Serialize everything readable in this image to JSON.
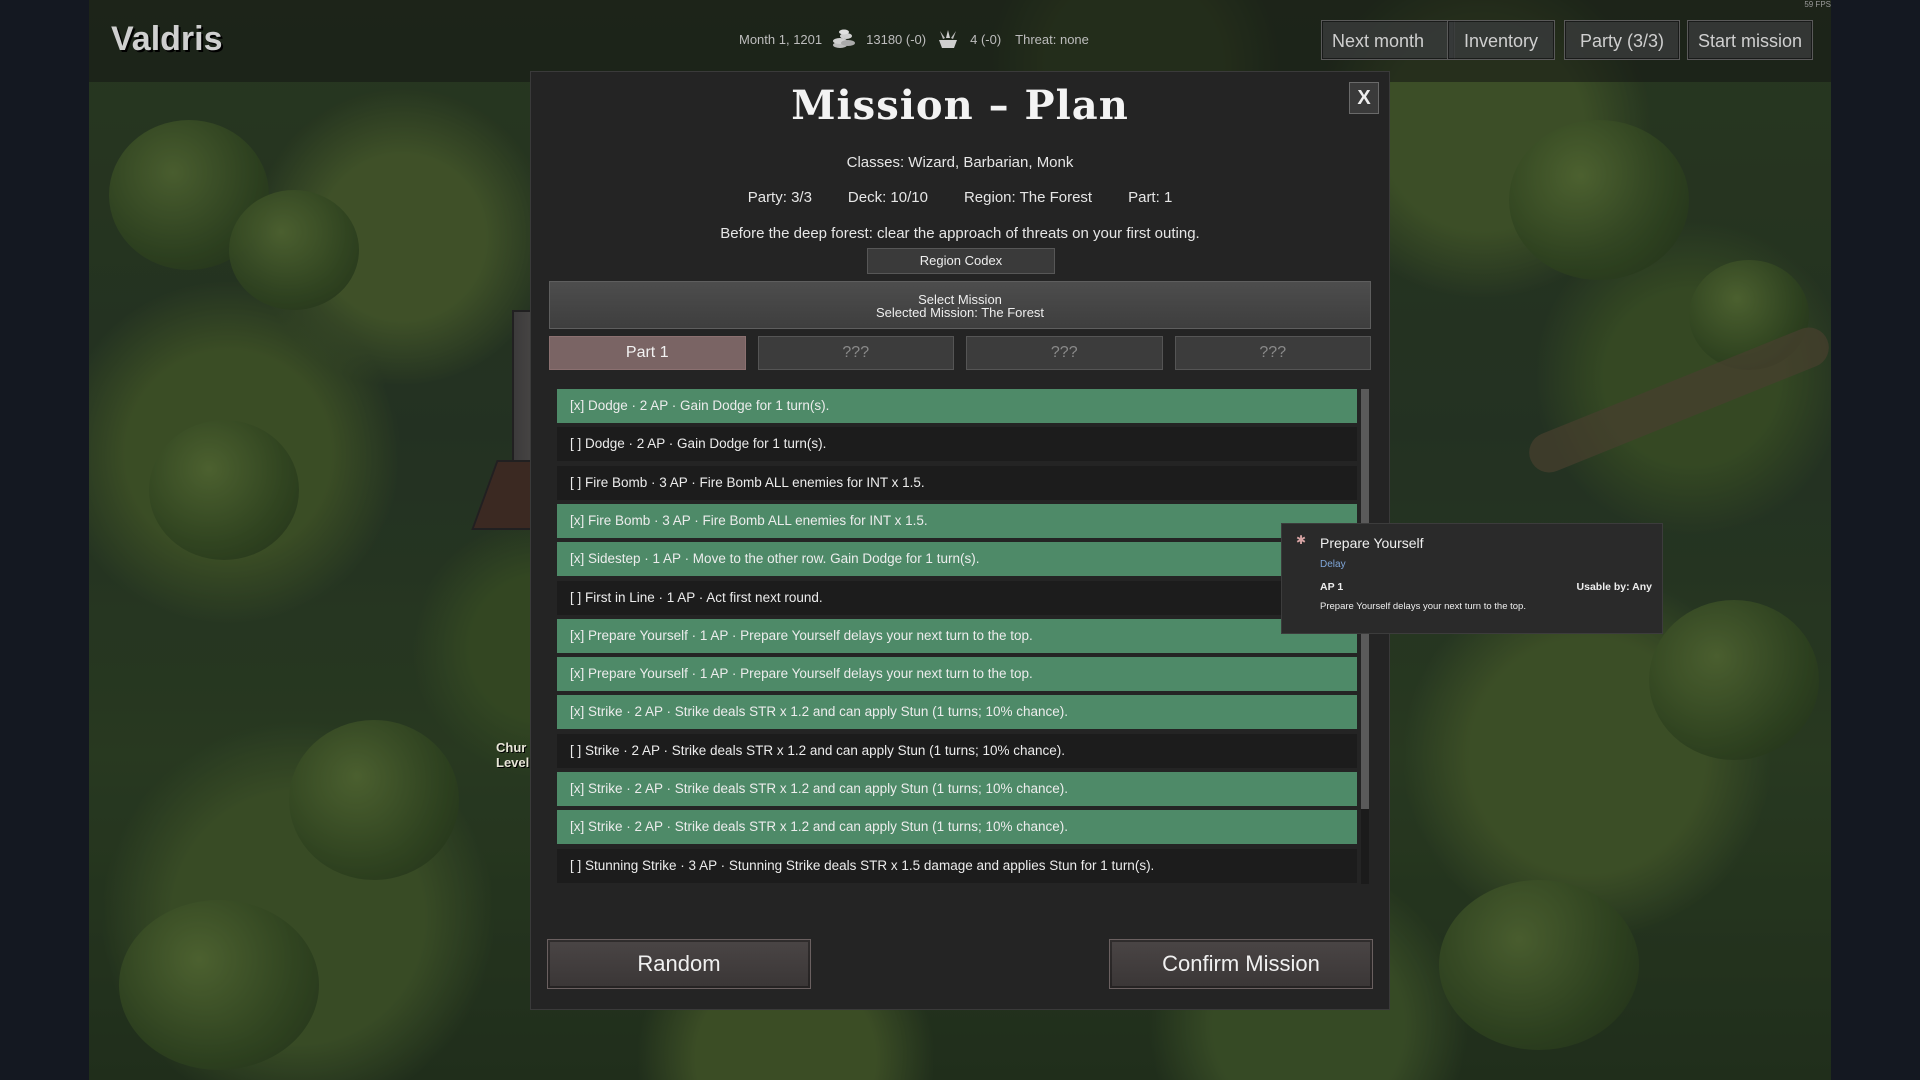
{
  "game": {
    "title": "Valdris",
    "fps": "59 FPS"
  },
  "status": {
    "date": "Month 1, 1201",
    "gold": "13180 (-0)",
    "supplies": "4 (-0)",
    "threat": "Threat: none"
  },
  "nav": {
    "next_month": "Next month",
    "inventory": "Inventory",
    "party": "Party (3/3)",
    "start_mission": "Start mission"
  },
  "map": {
    "church_label": "Chur",
    "church_level": "Level"
  },
  "modal": {
    "title": "Mission – Plan",
    "close": "X",
    "classes": "Classes: Wizard, Barbarian, Monk",
    "party": "Party: 3/3",
    "deck": "Deck: 10/10",
    "region": "Region: The Forest",
    "part": "Part: 1",
    "description": "Before the deep forest: clear the approach of threats on your first outing.",
    "codex_button": "Region Codex",
    "select_mission": "Select Mission",
    "selected_mission": "Selected Mission: The Forest",
    "tabs": [
      {
        "label": "Part 1",
        "active": true
      },
      {
        "label": "???",
        "active": false
      },
      {
        "label": "???",
        "active": false
      },
      {
        "label": "???",
        "active": false
      }
    ],
    "cards": [
      {
        "text": "[x] Dodge  ·  2 AP  ·  Gain Dodge for 1 turn(s).",
        "selected": true
      },
      {
        "text": "[ ] Dodge  ·  2 AP  ·  Gain Dodge for 1 turn(s).",
        "selected": false
      },
      {
        "text": "[ ] Fire Bomb  ·  3 AP  ·  Fire Bomb ALL enemies for INT x 1.5.",
        "selected": false
      },
      {
        "text": "[x] Fire Bomb  ·  3 AP  ·  Fire Bomb ALL enemies for INT x 1.5.",
        "selected": true
      },
      {
        "text": "[x] Sidestep  ·  1 AP  ·  Move to the other row. Gain Dodge for 1 turn(s).",
        "selected": true
      },
      {
        "text": "[ ] First in Line  ·  1 AP  ·  Act first next round.",
        "selected": false
      },
      {
        "text": "[x] Prepare Yourself  ·  1 AP  ·  Prepare Yourself delays your next turn to the top.",
        "selected": true
      },
      {
        "text": "[x] Prepare Yourself  ·  1 AP  ·  Prepare Yourself delays your next turn to the top.",
        "selected": true
      },
      {
        "text": "[x] Strike  ·  2 AP  ·  Strike deals STR x 1.2 and can apply Stun (1 turns; 10% chance).",
        "selected": true
      },
      {
        "text": "[ ] Strike  ·  2 AP  ·  Strike deals STR x 1.2 and can apply Stun (1 turns; 10% chance).",
        "selected": false
      },
      {
        "text": "[x] Strike  ·  2 AP  ·  Strike deals STR x 1.2 and can apply Stun (1 turns; 10% chance).",
        "selected": true
      },
      {
        "text": "[x] Strike  ·  2 AP  ·  Strike deals STR x 1.2 and can apply Stun (1 turns; 10% chance).",
        "selected": true
      },
      {
        "text": "[ ] Stunning Strike  ·  3 AP  ·  Stunning Strike deals STR x 1.5 damage and applies Stun for 1 turn(s).",
        "selected": false
      }
    ],
    "random_button": "Random",
    "confirm_button": "Confirm Mission"
  },
  "tooltip": {
    "name": "Prepare Yourself",
    "tag": "Delay",
    "ap": "AP 1",
    "usable": "Usable by: Any",
    "description": "Prepare Yourself delays your next turn to the top."
  },
  "colors": {
    "selected_row": "#4e8a68",
    "unselected_row": "#1c1c1c",
    "active_tab": "#7a6464",
    "tag_blue": "#7fa6d8"
  }
}
